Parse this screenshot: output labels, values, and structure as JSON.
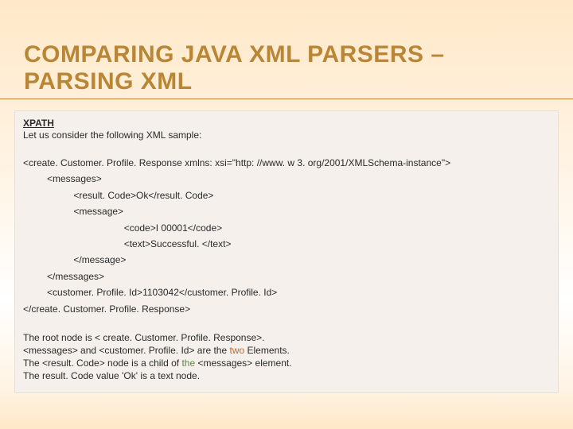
{
  "title": "COMPARING JAVA XML PARSERS – PARSING XML",
  "section_label": "XPATH",
  "intro": "Let us consider the following XML sample:",
  "xml": "<create. Customer. Profile. Response xmlns: xsi=\"http: //www. w 3. org/2001/XMLSchema-instance\">\n         <messages>\n                   <result. Code>Ok</result. Code>\n                   <message>\n                                      <code>I 00001</code>\n                                      <text>Successful. </text>\n                   </message>\n         </messages>\n         <customer. Profile. Id>1103042</customer. Profile. Id>\n</create. Customer. Profile. Response>",
  "notes": {
    "line1_pre": "The root node is < create. Customer. Profile. Response>.",
    "line2_pre": "<messages> and <customer. Profile. Id> are the ",
    "line2_kw": "two",
    "line2_post": " Elements.",
    "line3_pre": "The <result. Code> node is a child of ",
    "line3_kw": "the",
    "line3_post": " <messages> element.",
    "line4": "The result. Code value 'Ok' is a text node."
  }
}
